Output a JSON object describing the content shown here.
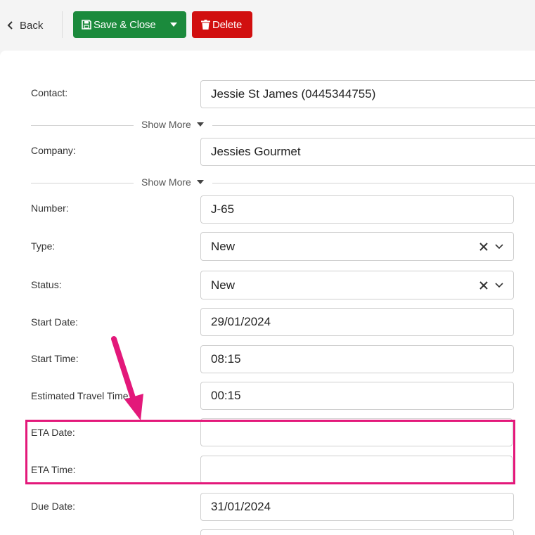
{
  "toolbar": {
    "back_label": "Back",
    "save_close_label": "Save & Close",
    "delete_label": "Delete"
  },
  "form": {
    "contact": {
      "label": "Contact:",
      "value": "Jessie St James (0445344755)"
    },
    "show_more_1": "Show More",
    "company": {
      "label": "Company:",
      "value": "Jessies Gourmet"
    },
    "show_more_2": "Show More",
    "number": {
      "label": "Number:",
      "value": "J-65"
    },
    "type": {
      "label": "Type:",
      "value": "New"
    },
    "status": {
      "label": "Status:",
      "value": "New"
    },
    "start_date": {
      "label": "Start Date:",
      "value": "29/01/2024"
    },
    "start_time": {
      "label": "Start Time:",
      "value": "08:15"
    },
    "travel_time": {
      "label": "Estimated Travel Time:",
      "value": "00:15"
    },
    "eta_date": {
      "label": "ETA Date:",
      "value": ""
    },
    "eta_time": {
      "label": "ETA Time:",
      "value": ""
    },
    "due_date": {
      "label": "Due Date:",
      "value": "31/01/2024"
    }
  },
  "icons": {
    "back": "chevron-left-icon",
    "save": "floppy-disk-icon",
    "dropdown": "caret-down-icon",
    "delete": "trash-icon",
    "clear": "x-icon",
    "select": "chevron-down-icon"
  },
  "colors": {
    "save_button": "#1b8a3c",
    "delete_button": "#d10f0f",
    "highlight": "#e3187a"
  }
}
